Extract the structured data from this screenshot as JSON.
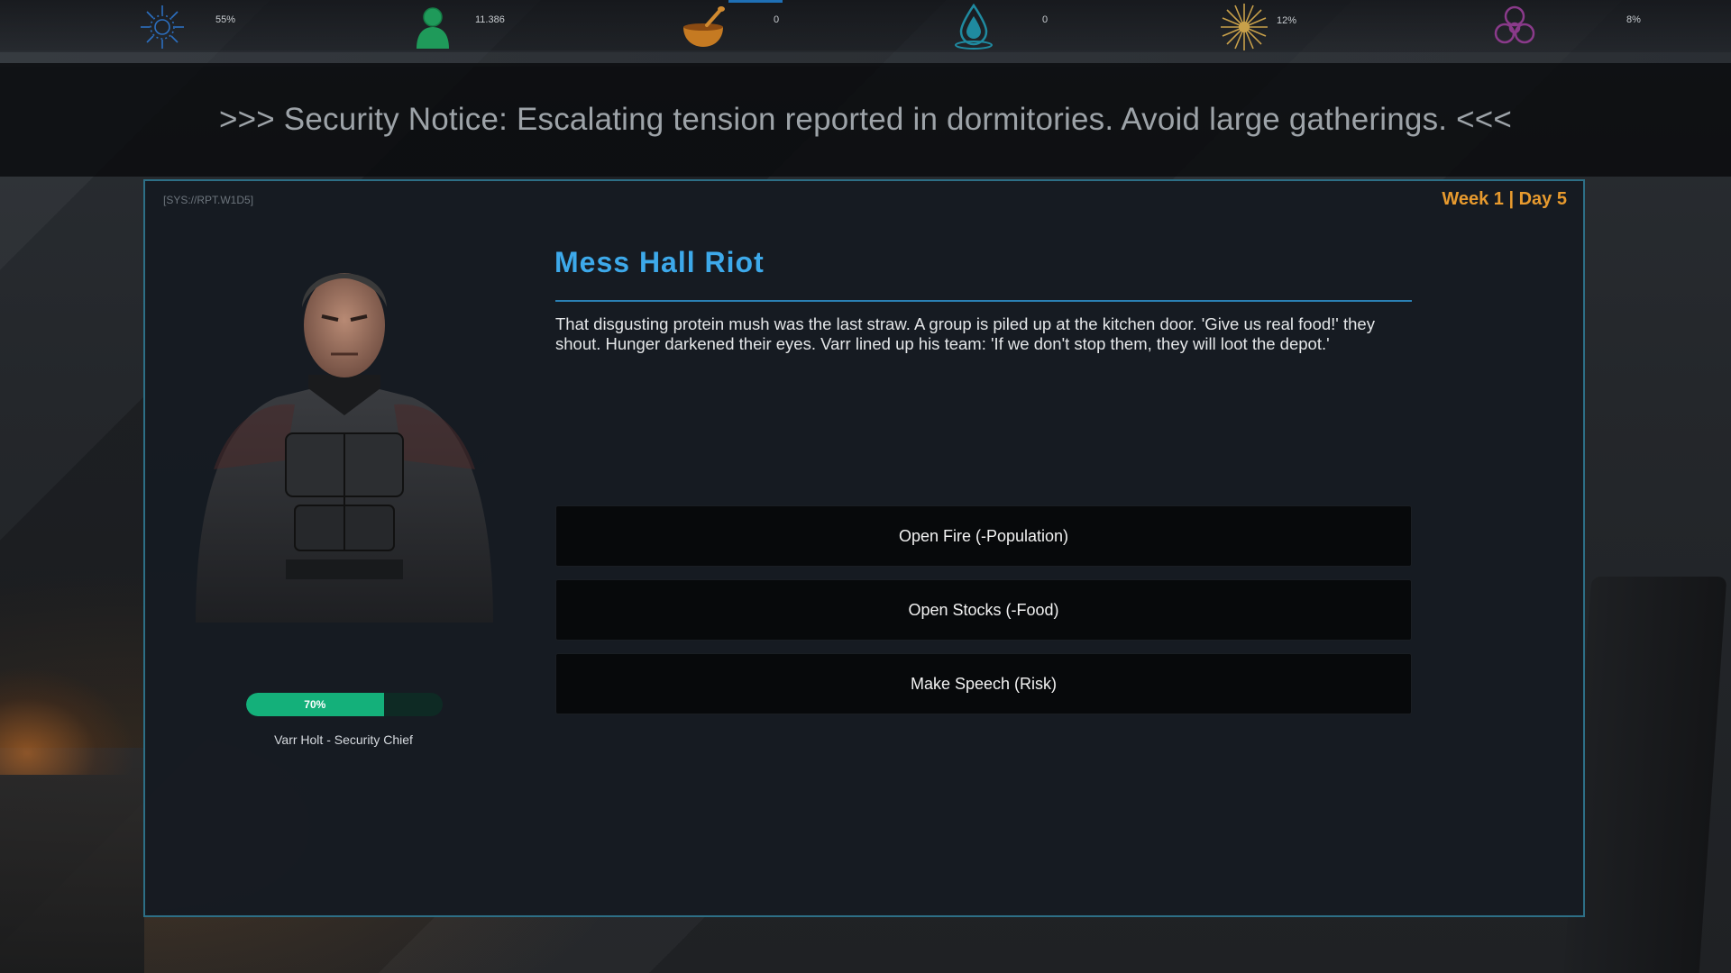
{
  "resources": [
    {
      "icon": "sun-shield-icon",
      "value": "55%",
      "color": "#2c6fc0"
    },
    {
      "icon": "population-icon",
      "value": "11.386",
      "color": "#1f9a5a"
    },
    {
      "icon": "food-bowl-icon",
      "value": "0",
      "color": "#c57a22"
    },
    {
      "icon": "water-drop-icon",
      "value": "0",
      "color": "#1f8aa0"
    },
    {
      "icon": "energy-burst-icon",
      "value": "12%",
      "color": "#c8a04a"
    },
    {
      "icon": "biohazard-icon",
      "value": "8%",
      "color": "#8a3a8a"
    }
  ],
  "ticker": {
    "text": ">>> Security Notice: Escalating tension reported in dormitories. Avoid large gatherings. <<<"
  },
  "panel": {
    "sys_code": "[SYS://RPT.W1D5]",
    "week_day": "Week 1 | Day 5"
  },
  "character": {
    "name": "Varr Holt - Security Chief",
    "approval_label": "70%",
    "approval": 0.7
  },
  "event": {
    "title": "Mess Hall Riot",
    "text": "That disgusting protein mush was the last straw. A group is piled up at the kitchen door. 'Give us real food!' they shout. Hunger darkened their eyes. Varr lined up his team: 'If we don't stop them, they will loot the depot.'"
  },
  "choices": [
    {
      "label": "Open Fire (-Population)"
    },
    {
      "label": "Open Stocks (-Food)"
    },
    {
      "label": "Make Speech (Risk)"
    }
  ],
  "colors": {
    "accent": "#3da9ea",
    "highlight": "#e79a2e",
    "progress": "#14b07a"
  }
}
